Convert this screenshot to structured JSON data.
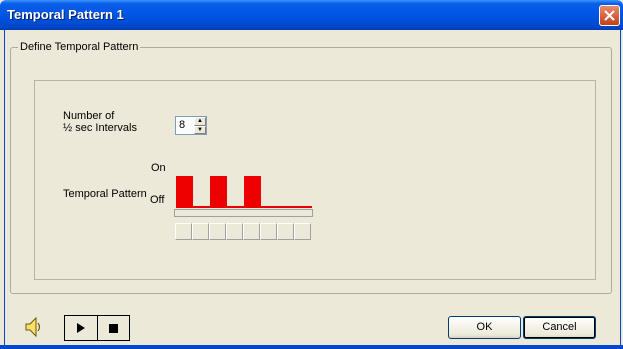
{
  "window": {
    "title": "Temporal Pattern 1"
  },
  "group": {
    "label": "Define Temporal Pattern"
  },
  "intervals": {
    "label_line1": "Number of",
    "label_line2": "½ sec Intervals",
    "value": "8"
  },
  "pattern": {
    "label": "Temporal Pattern",
    "on_label": "On",
    "off_label": "Off",
    "states": [
      1,
      0,
      1,
      0,
      1,
      0,
      0,
      0
    ],
    "wave_color": "#ee0000"
  },
  "buttons": {
    "ok": "OK",
    "cancel": "Cancel"
  },
  "icons": {
    "speaker": "speaker-icon",
    "play": "play-icon",
    "stop": "stop-icon",
    "close": "close-icon"
  }
}
